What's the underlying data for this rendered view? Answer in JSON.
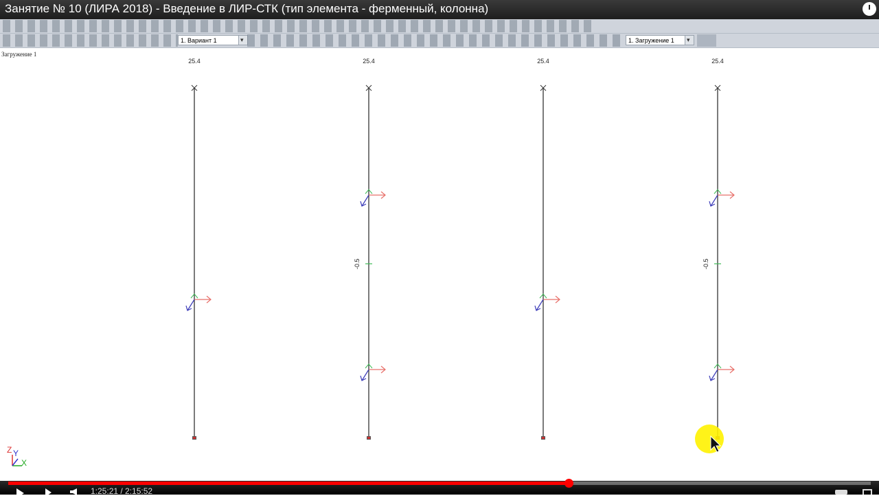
{
  "video": {
    "title": "Занятие № 10 (ЛИРА 2018) - Введение в ЛИР-СТК (тип элемента - ферменный, колонна)",
    "time_display": "1:25:21 / 2:15:52",
    "progress_fraction": 0.65
  },
  "toolbar": {
    "variant_combo": "1. Вариант 1",
    "load_combo": "1. Загружение 1"
  },
  "canvas": {
    "load_case_label": "Загружение 1",
    "columns": [
      {
        "top_label": "25.4",
        "side_label": "",
        "axis_markers": 1
      },
      {
        "top_label": "25.4",
        "side_label": "-0.5",
        "axis_markers": 2
      },
      {
        "top_label": "25.4",
        "side_label": "",
        "axis_markers": 1
      },
      {
        "top_label": "25.4",
        "side_label": "-0.5",
        "axis_markers": 2
      }
    ],
    "axes": {
      "z": "Z",
      "y": "Y",
      "x": "X"
    }
  },
  "colors": {
    "progress": "#ff0000",
    "local_axis_x": "#e8706a",
    "local_axis_y": "#3a3ab8",
    "local_axis_z": "#3dbb55",
    "cursor_highlight": "#fff200"
  }
}
